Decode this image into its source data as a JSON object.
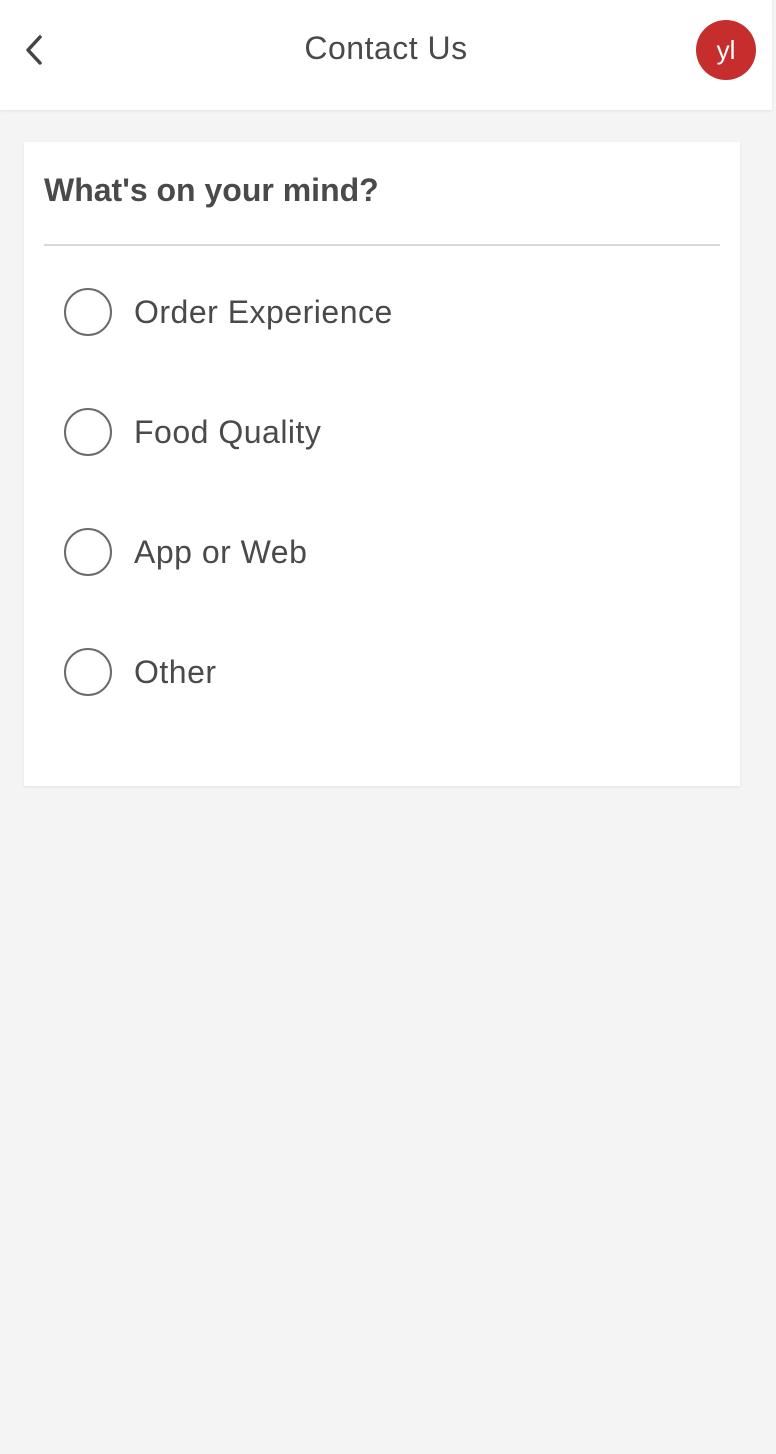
{
  "colors": {
    "avatar_bg": "#c62e2e",
    "page_bg": "#f4f4f4"
  },
  "header": {
    "back_icon": "chevron-left-icon",
    "title": "Contact Us",
    "avatar_initials": "yl"
  },
  "card": {
    "title": "What's on your mind?",
    "options": [
      {
        "label": "Order Experience",
        "selected": false
      },
      {
        "label": "Food Quality",
        "selected": false
      },
      {
        "label": "App or Web",
        "selected": false
      },
      {
        "label": "Other",
        "selected": false
      }
    ]
  }
}
